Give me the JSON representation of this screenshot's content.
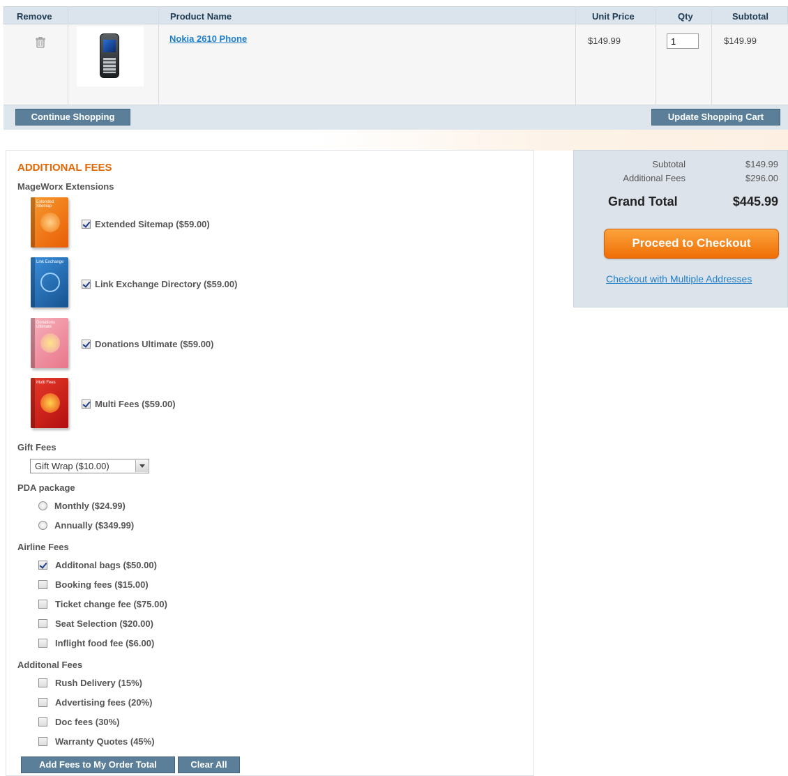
{
  "cart": {
    "headers": {
      "remove": "Remove",
      "product_name": "Product Name",
      "unit_price": "Unit Price",
      "qty": "Qty",
      "subtotal": "Subtotal"
    },
    "item": {
      "name": "Nokia 2610 Phone",
      "unit_price": "$149.99",
      "qty": "1",
      "subtotal": "$149.99"
    },
    "continue_label": "Continue Shopping",
    "update_label": "Update Shopping Cart"
  },
  "fees": {
    "title": "ADDITIONAL FEES",
    "extensions": {
      "title": "MageWorx Extensions",
      "items": [
        {
          "label": "Extended Sitemap ($59.00)",
          "checked": true,
          "box_text": "Extended Sitemap",
          "color": "#f27a14"
        },
        {
          "label": "Link Exchange Directory ($59.00)",
          "checked": true,
          "box_text": "Link Exchange",
          "color": "#2b79c6"
        },
        {
          "label": "Donations Ultimate ($59.00)",
          "checked": true,
          "box_text": "Donations Ultimate",
          "color": "#f08a9a"
        },
        {
          "label": "Multi Fees ($59.00)",
          "checked": true,
          "box_text": "Multi Fees",
          "color": "#d41f1f"
        }
      ]
    },
    "gift": {
      "title": "Gift Fees",
      "selected": "Gift Wrap ($10.00)"
    },
    "pda": {
      "title": "PDA package",
      "options": [
        "Monthly ($24.99)",
        "Annually ($349.99)"
      ]
    },
    "airline": {
      "title": "Airline Fees",
      "items": [
        {
          "label": "Additonal bags ($50.00)",
          "checked": true
        },
        {
          "label": "Booking fees ($15.00)",
          "checked": false
        },
        {
          "label": "Ticket change fee ($75.00)",
          "checked": false
        },
        {
          "label": "Seat Selection ($20.00)",
          "checked": false
        },
        {
          "label": "Inflight food fee ($6.00)",
          "checked": false
        }
      ]
    },
    "additional": {
      "title": "Additonal Fees",
      "items": [
        {
          "label": "Rush Delivery (15%)",
          "checked": false
        },
        {
          "label": "Advertising fees (20%)",
          "checked": false
        },
        {
          "label": "Doc fees (30%)",
          "checked": false
        },
        {
          "label": "Warranty Quotes (45%)",
          "checked": false
        }
      ]
    },
    "add_label": "Add Fees to My Order Total",
    "clear_label": "Clear All"
  },
  "totals": {
    "subtotal_label": "Subtotal",
    "subtotal_value": "$149.99",
    "fees_label": "Additional Fees",
    "fees_value": "$296.00",
    "grand_label": "Grand Total",
    "grand_value": "$445.99",
    "checkout_label": "Proceed to Checkout",
    "multi_label": "Checkout with Multiple Addresses"
  },
  "colors": {
    "accent_orange": "#e26703",
    "button_steel": "#5b7f99",
    "link_blue": "#1e7ec8"
  }
}
